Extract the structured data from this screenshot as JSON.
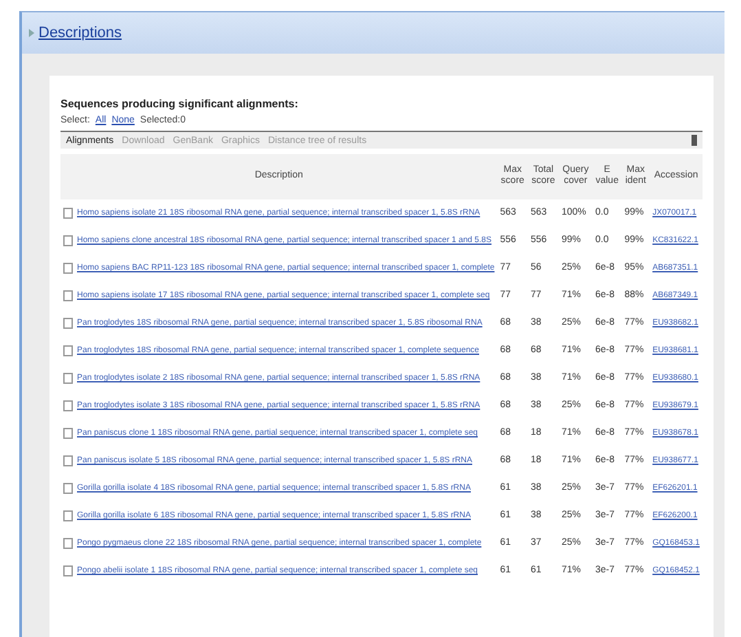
{
  "section": {
    "title": "Descriptions"
  },
  "heading": "Sequences producing significant alignments:",
  "select": {
    "label": "Select:",
    "links": [
      "All",
      "None"
    ],
    "status": "Selected:0"
  },
  "toolbar": {
    "title": "Alignments",
    "actions": [
      "Download",
      "GenBank",
      "Graphics",
      "Distance tree of results"
    ]
  },
  "table": {
    "columns": [
      "Description",
      "Max score",
      "Total score",
      "Query cover",
      "E value",
      "Max ident",
      "Accession"
    ],
    "rows": [
      {
        "checked": false,
        "cells": [
          "Homo sapiens isolate 21 18S ribosomal RNA gene, partial sequence; internal transcribed spacer 1, 5.8S rRNA",
          "563",
          "563",
          "100%",
          "0.0",
          "99%",
          "JX070017.1"
        ]
      },
      {
        "checked": false,
        "cells": [
          "Homo sapiens clone ancestral 18S ribosomal RNA gene, partial sequence; internal transcribed spacer 1 and 5.8S",
          "556",
          "556",
          "99%",
          "0.0",
          "99%",
          "KC831622.1"
        ]
      },
      {
        "checked": false,
        "cells": [
          "Homo sapiens BAC RP11-123 18S ribosomal RNA gene, partial sequence; internal transcribed spacer 1, complete",
          "77",
          "56",
          "25%",
          "6e-8",
          "95%",
          "AB687351.1"
        ]
      },
      {
        "checked": false,
        "cells": [
          "Homo sapiens isolate 17 18S ribosomal RNA gene, partial sequence; internal transcribed spacer 1, complete seq",
          "77",
          "77",
          "71%",
          "6e-8",
          "88%",
          "AB687349.1"
        ]
      },
      {
        "checked": false,
        "cells": [
          "Pan troglodytes 18S ribosomal RNA gene, partial sequence; internal transcribed spacer 1, 5.8S ribosomal RNA",
          "68",
          "38",
          "25%",
          "6e-8",
          "77%",
          "EU938682.1"
        ]
      },
      {
        "checked": false,
        "cells": [
          "Pan troglodytes 18S ribosomal RNA gene, partial sequence; internal transcribed spacer 1, complete sequence",
          "68",
          "68",
          "71%",
          "6e-8",
          "77%",
          "EU938681.1"
        ]
      },
      {
        "checked": false,
        "cells": [
          "Pan troglodytes isolate 2 18S ribosomal RNA gene, partial sequence; internal transcribed spacer 1, 5.8S rRNA",
          "68",
          "38",
          "71%",
          "6e-8",
          "77%",
          "EU938680.1"
        ]
      },
      {
        "checked": false,
        "cells": [
          "Pan troglodytes isolate 3 18S ribosomal RNA gene, partial sequence; internal transcribed spacer 1, 5.8S rRNA",
          "68",
          "38",
          "25%",
          "6e-8",
          "77%",
          "EU938679.1"
        ]
      },
      {
        "checked": false,
        "cells": [
          "Pan paniscus clone 1 18S ribosomal RNA gene, partial sequence; internal transcribed spacer 1, complete seq",
          "68",
          "18",
          "71%",
          "6e-8",
          "77%",
          "EU938678.1"
        ]
      },
      {
        "checked": false,
        "cells": [
          "Pan paniscus isolate 5 18S ribosomal RNA gene, partial sequence; internal transcribed spacer 1, 5.8S rRNA",
          "68",
          "18",
          "71%",
          "6e-8",
          "77%",
          "EU938677.1"
        ]
      },
      {
        "checked": false,
        "cells": [
          "Gorilla gorilla isolate 4 18S ribosomal RNA gene, partial sequence; internal transcribed spacer 1, 5.8S rRNA",
          "61",
          "38",
          "25%",
          "3e-7",
          "77%",
          "EF626201.1"
        ]
      },
      {
        "checked": false,
        "cells": [
          "Gorilla gorilla isolate 6 18S ribosomal RNA gene, partial sequence; internal transcribed spacer 1, 5.8S rRNA",
          "61",
          "38",
          "25%",
          "3e-7",
          "77%",
          "EF626200.1"
        ]
      },
      {
        "checked": false,
        "cells": [
          "Pongo pygmaeus clone 22 18S ribosomal RNA gene, partial sequence; internal transcribed spacer 1, complete",
          "61",
          "37",
          "25%",
          "3e-7",
          "77%",
          "GQ168453.1"
        ]
      },
      {
        "checked": false,
        "cells": [
          "Pongo abelii isolate 1 18S ribosomal RNA gene, partial sequence; internal transcribed spacer 1, complete seq",
          "61",
          "61",
          "71%",
          "3e-7",
          "77%",
          "GQ168452.1"
        ]
      }
    ]
  }
}
